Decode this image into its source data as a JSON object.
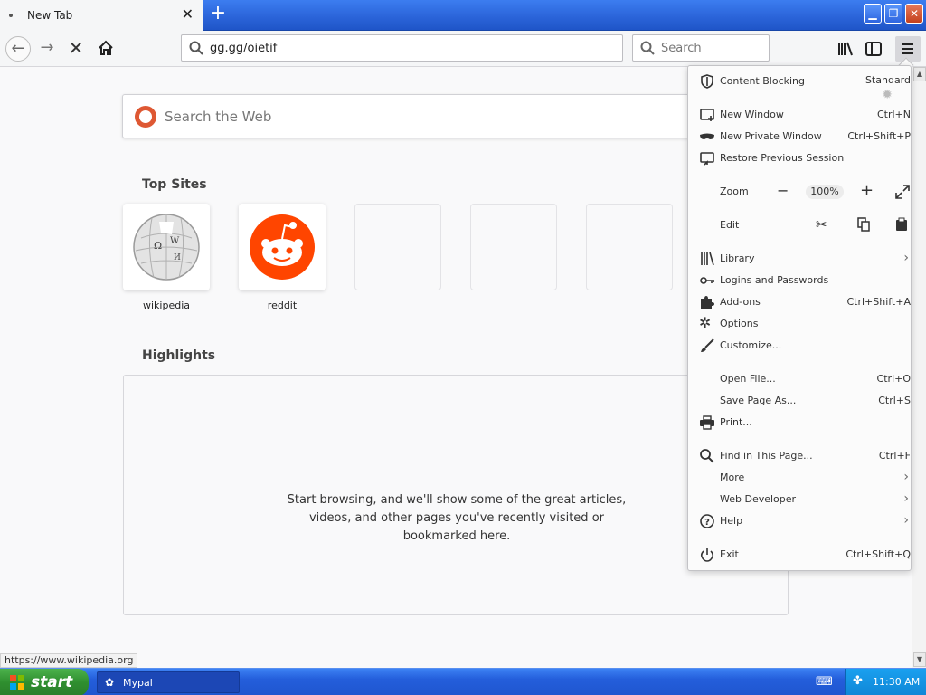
{
  "browser": {
    "tab_title": "New Tab",
    "url": "gg.gg/oietif",
    "search_placeholder": "Search"
  },
  "newtab": {
    "search_placeholder": "Search the Web",
    "top_sites_title": "Top Sites",
    "top_sites": [
      {
        "label": "wikipedia"
      },
      {
        "label": "reddit"
      },
      {
        "label": ""
      },
      {
        "label": ""
      },
      {
        "label": ""
      }
    ],
    "highlights_title": "Highlights",
    "highlights_message": "Start browsing, and we'll show some of the great articles, videos, and other pages you've recently visited or bookmarked here."
  },
  "status_url": "https://www.wikipedia.org",
  "menu": {
    "content_blocking": {
      "label": "Content Blocking",
      "value": "Standard"
    },
    "new_window": {
      "label": "New Window",
      "shortcut": "Ctrl+N"
    },
    "new_private_window": {
      "label": "New Private Window",
      "shortcut": "Ctrl+Shift+P"
    },
    "restore_session": {
      "label": "Restore Previous Session"
    },
    "zoom": {
      "label": "Zoom",
      "value": "100%"
    },
    "edit": {
      "label": "Edit"
    },
    "library": {
      "label": "Library"
    },
    "logins": {
      "label": "Logins and Passwords"
    },
    "addons": {
      "label": "Add-ons",
      "shortcut": "Ctrl+Shift+A"
    },
    "options": {
      "label": "Options"
    },
    "customize": {
      "label": "Customize..."
    },
    "open_file": {
      "label": "Open File...",
      "shortcut": "Ctrl+O"
    },
    "save_page": {
      "label": "Save Page As...",
      "shortcut": "Ctrl+S"
    },
    "print": {
      "label": "Print..."
    },
    "find": {
      "label": "Find in This Page...",
      "shortcut": "Ctrl+F"
    },
    "more": {
      "label": "More"
    },
    "web_developer": {
      "label": "Web Developer"
    },
    "help": {
      "label": "Help"
    },
    "exit": {
      "label": "Exit",
      "shortcut": "Ctrl+Shift+Q"
    }
  },
  "taskbar": {
    "start_label": "start",
    "task_label": "Mypal",
    "clock": "11:30 AM"
  },
  "colors": {
    "ddg": "#de5833",
    "reddit": "#ff4500",
    "xp_blue": "#245edb",
    "xp_green": "#2f8f2f"
  }
}
